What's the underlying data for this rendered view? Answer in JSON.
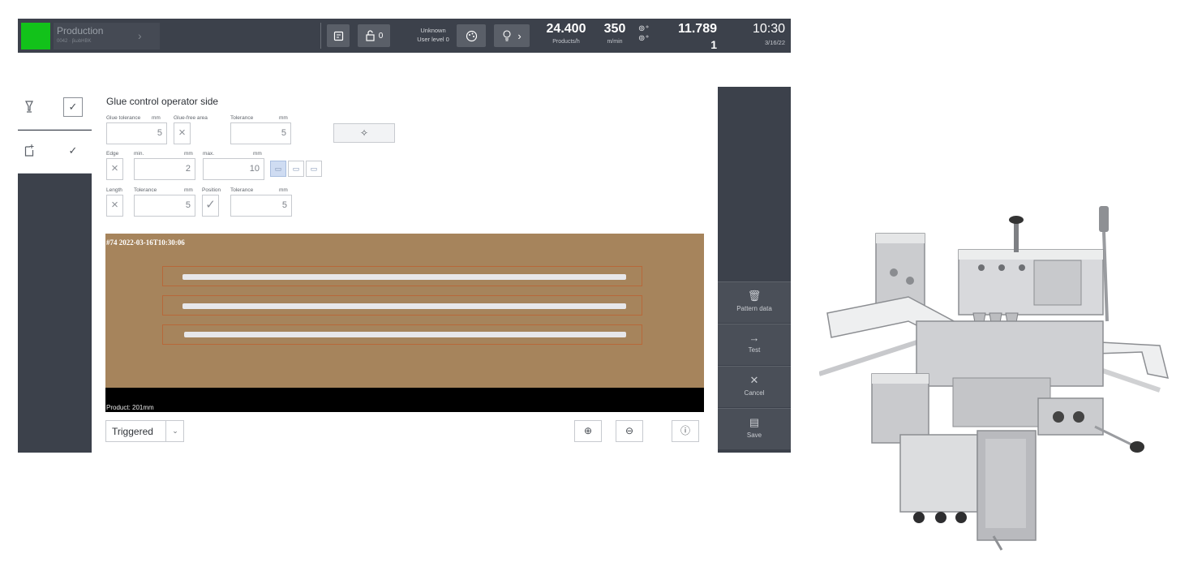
{
  "topbar": {
    "mode_title": "Production",
    "mode_sub": "0042 · βωbHBK",
    "lock_count": "0",
    "user_name": "Unknown",
    "user_level": "User level 0",
    "rate_value": "24.400",
    "rate_unit": "Products/h",
    "speed_value": "350",
    "speed_unit": "m/min",
    "counter_main": "11.789",
    "counter_sub": "1",
    "time": "10:30",
    "date": "3/16/22",
    "status_color": "#12c21a"
  },
  "left_nav": [
    {
      "icon": "glue-valve-icon"
    },
    {
      "icon": "sheet-icon"
    }
  ],
  "main": {
    "title": "Glue control operator side",
    "row1": {
      "glue_tolerance_label": "Glue tolerance",
      "glue_tolerance_unit": "mm",
      "glue_tolerance_value": "5",
      "glue_free_label": "Glue-free area",
      "tolerance_label": "Tolerance",
      "tolerance_unit": "mm",
      "tolerance_value": "5"
    },
    "row2": {
      "edge_label": "Edge",
      "min_label": "min.",
      "min_unit": "mm",
      "min_value": "2",
      "max_label": "max.",
      "max_unit": "mm",
      "max_value": "10"
    },
    "row3": {
      "length_label": "Length",
      "length_tol_label": "Tolerance",
      "length_tol_unit": "mm",
      "length_tol_value": "5",
      "position_label": "Position",
      "position_tol_label": "Tolerance",
      "position_tol_unit": "mm",
      "position_tol_value": "5"
    }
  },
  "viewer": {
    "caption": "#74 2022-03-16T10:30:06",
    "product_label": "Product: 201mm",
    "board_color": "#a6845c"
  },
  "bottom": {
    "trigger_mode": "Triggered"
  },
  "right_panel": {
    "pattern_label": "Pattern data",
    "test_label": "Test",
    "cancel_label": "Cancel",
    "save_label": "Save"
  }
}
